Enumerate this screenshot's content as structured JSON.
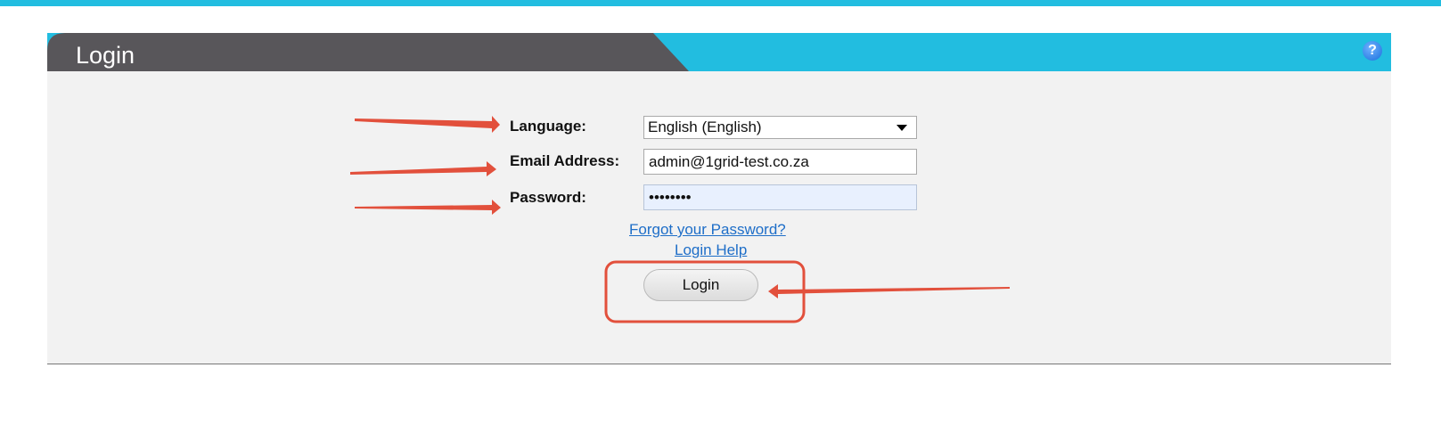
{
  "colors": {
    "accent": "#22bde0",
    "header_dark": "#58565a",
    "panel_bg": "#f2f2f2",
    "link": "#1e6ec8",
    "annotation": "#e2503c"
  },
  "header": {
    "title": "Login",
    "help_icon": "question-mark-icon",
    "help_symbol": "?"
  },
  "form": {
    "language": {
      "label": "Language:",
      "selected": "English (English)"
    },
    "email": {
      "label": "Email Address:",
      "value": "admin@1grid-test.co.za"
    },
    "password": {
      "label": "Password:",
      "value": "••••••••"
    },
    "forgot_link": "Forgot your Password?",
    "help_link": "Login Help",
    "login_button": "Login"
  }
}
